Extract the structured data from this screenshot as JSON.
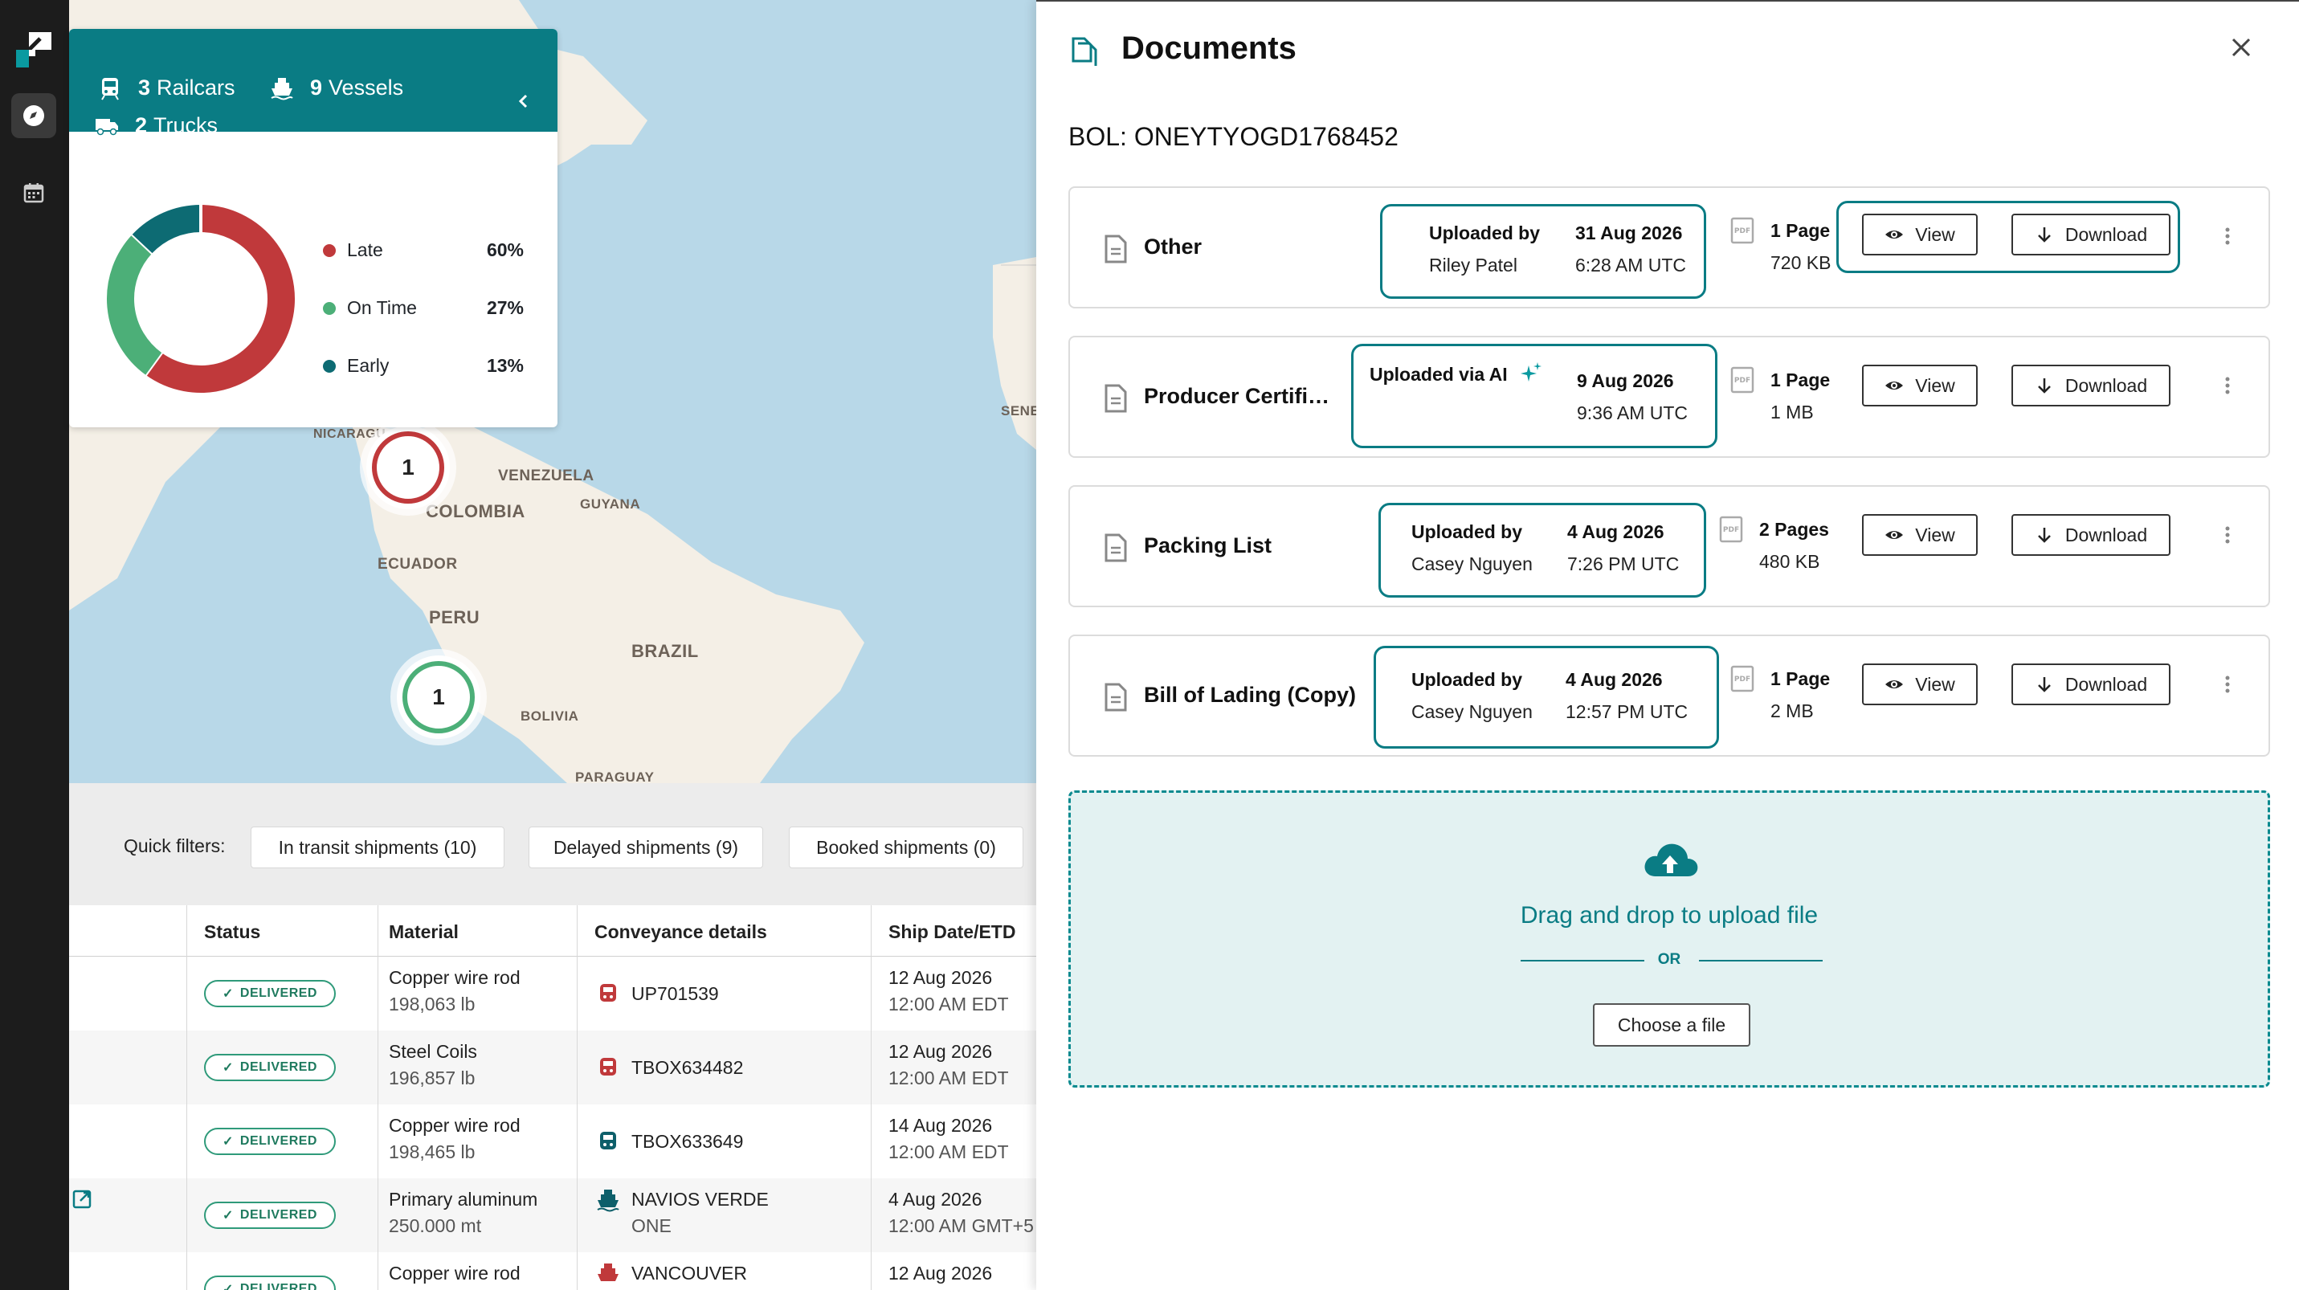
{
  "map": {
    "countries": [
      "NICARAGU",
      "VENEZUELA",
      "COLOMBIA",
      "GUYANA",
      "ECUADOR",
      "PERU",
      "BRAZIL",
      "BOLIVIA",
      "PARAGUAY",
      "SENE"
    ],
    "clusters": [
      {
        "count": "1",
        "status": "late",
        "color": "#c0393b"
      },
      {
        "count": "1",
        "status": "on-time",
        "color": "#4caf78"
      }
    ]
  },
  "summary": {
    "railcars_count": "3",
    "railcars_label": "Railcars",
    "vessels_count": "9",
    "vessels_label": "Vessels",
    "trucks_count": "2",
    "trucks_label": "Trucks",
    "chart_data": {
      "type": "pie",
      "donut": true,
      "categories": [
        "Late",
        "On Time",
        "Early"
      ],
      "values": [
        60,
        27,
        13
      ],
      "labels": [
        "60%",
        "27%",
        "13%"
      ],
      "colors": [
        "#c0393b",
        "#4caf78",
        "#0d6b73"
      ]
    }
  },
  "filters": {
    "label": "Quick filters:",
    "chips": [
      "In transit shipments (10)",
      "Delayed shipments (9)",
      "Booked shipments (0)"
    ]
  },
  "table": {
    "headers": [
      "Status",
      "Material",
      "Conveyance details",
      "Ship Date/ETD"
    ],
    "rows": [
      {
        "status": "DELIVERED",
        "material": "Copper wire rod",
        "qty": "198,063 lb",
        "conveyance": "UP701539",
        "conveyance_sub": "",
        "mode": "rail",
        "date": "12 Aug 2026",
        "time": "12:00 AM EDT"
      },
      {
        "status": "DELIVERED",
        "material": "Steel Coils",
        "qty": "196,857 lb",
        "conveyance": "TBOX634482",
        "conveyance_sub": "",
        "mode": "rail",
        "date": "12 Aug 2026",
        "time": "12:00 AM EDT"
      },
      {
        "status": "DELIVERED",
        "material": "Copper wire rod",
        "qty": "198,465 lb",
        "conveyance": "TBOX633649",
        "conveyance_sub": "",
        "mode": "rail-teal",
        "date": "14 Aug 2026",
        "time": "12:00 AM EDT"
      },
      {
        "status": "DELIVERED",
        "material": "Primary aluminum",
        "qty": "250.000 mt",
        "conveyance": "NAVIOS VERDE",
        "conveyance_sub": "ONE",
        "mode": "vessel",
        "date": "4 Aug 2026",
        "time": "12:00 AM GMT+5"
      },
      {
        "status": "DELIVERED",
        "material": "Copper wire rod",
        "qty": "",
        "conveyance": "VANCOUVER",
        "conveyance_sub": "",
        "mode": "vessel-red",
        "date": "12 Aug 2026",
        "time": ""
      }
    ]
  },
  "drawer": {
    "title": "Documents",
    "bol": "BOL: ONEYTYOGD1768452",
    "view_label": "View",
    "download_label": "Download",
    "documents": [
      {
        "name": "Other",
        "upload_label": "Uploaded by",
        "uploader": "Riley Patel",
        "date": "31 Aug 2026",
        "time": "6:28 AM UTC",
        "pages": "1 Page",
        "size": "720 KB"
      },
      {
        "name": "Producer Certificate",
        "upload_label": "Uploaded via AI",
        "uploader": "",
        "date": "9 Aug 2026",
        "time": "9:36 AM UTC",
        "pages": "1 Page",
        "size": "1 MB"
      },
      {
        "name": "Packing List",
        "upload_label": "Uploaded by",
        "uploader": "Casey Nguyen",
        "date": "4 Aug 2026",
        "time": "7:26 PM UTC",
        "pages": "2 Pages",
        "size": "480 KB"
      },
      {
        "name": "Bill of Lading (Copy)",
        "upload_label": "Uploaded by",
        "uploader": "Casey Nguyen",
        "date": "4 Aug 2026",
        "time": "12:57 PM UTC",
        "pages": "1 Page",
        "size": "2 MB"
      }
    ],
    "dropzone": {
      "text": "Drag and drop to upload file",
      "or": "OR",
      "choose": "Choose a file"
    }
  }
}
